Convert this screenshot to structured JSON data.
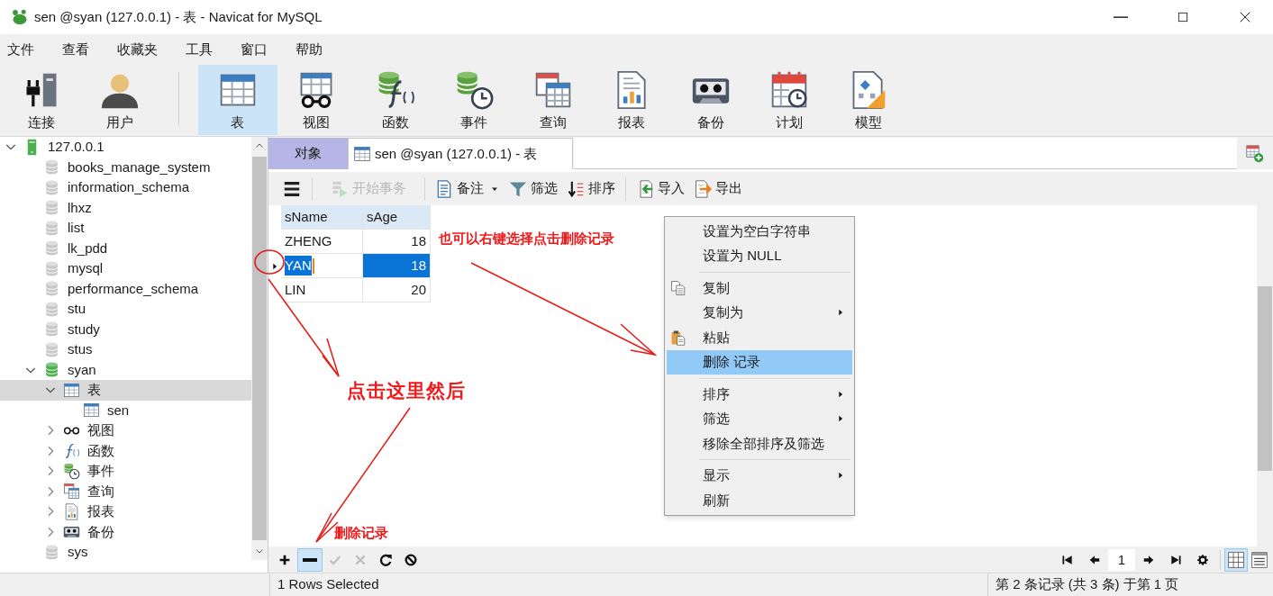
{
  "window": {
    "title": "sen @syan (127.0.0.1) - 表 - Navicat for MySQL"
  },
  "menu": [
    "文件",
    "查看",
    "收藏夹",
    "工具",
    "窗口",
    "帮助"
  ],
  "toolbar": {
    "connection": [
      {
        "kind": "connect",
        "label": "连接",
        "selected": false
      },
      {
        "kind": "user",
        "label": "用户",
        "selected": false
      }
    ],
    "objects": [
      {
        "kind": "table",
        "label": "表",
        "selected": true
      },
      {
        "kind": "view",
        "label": "视图",
        "selected": false
      },
      {
        "kind": "function",
        "label": "函数",
        "selected": false
      },
      {
        "kind": "event",
        "label": "事件",
        "selected": false
      },
      {
        "kind": "query",
        "label": "查询",
        "selected": false
      },
      {
        "kind": "report",
        "label": "报表",
        "selected": false
      },
      {
        "kind": "backup",
        "label": "备份",
        "selected": false
      },
      {
        "kind": "schedule",
        "label": "计划",
        "selected": false
      },
      {
        "kind": "model",
        "label": "模型",
        "selected": false
      }
    ]
  },
  "tree": [
    {
      "label": "127.0.0.1",
      "kind": "server",
      "expanded": true,
      "selected": false,
      "children": [
        {
          "label": "books_manage_system",
          "kind": "database",
          "open": false,
          "selected": false
        },
        {
          "label": "information_schema",
          "kind": "database",
          "open": false,
          "selected": false
        },
        {
          "label": "lhxz",
          "kind": "database",
          "open": false,
          "selected": false
        },
        {
          "label": "list",
          "kind": "database",
          "open": false,
          "selected": false
        },
        {
          "label": "lk_pdd",
          "kind": "database",
          "open": false,
          "selected": false
        },
        {
          "label": "mysql",
          "kind": "database",
          "open": false,
          "selected": false
        },
        {
          "label": "performance_schema",
          "kind": "database",
          "open": false,
          "selected": false
        },
        {
          "label": "stu",
          "kind": "database",
          "open": false,
          "selected": false
        },
        {
          "label": "study",
          "kind": "database",
          "open": false,
          "selected": false
        },
        {
          "label": "stus",
          "kind": "database",
          "open": false,
          "selected": false
        },
        {
          "label": "syan",
          "kind": "database",
          "open": true,
          "expanded": true,
          "selected": false,
          "children": [
            {
              "label": "表",
              "kind": "tables",
              "expanded": true,
              "selected": true,
              "children": [
                {
                  "label": "sen",
                  "kind": "table",
                  "selected": false
                }
              ]
            },
            {
              "label": "视图",
              "kind": "views",
              "expanded": false,
              "selected": false
            },
            {
              "label": "函数",
              "kind": "functions",
              "expanded": false,
              "selected": false
            },
            {
              "label": "事件",
              "kind": "events",
              "expanded": false,
              "selected": false
            },
            {
              "label": "查询",
              "kind": "queries",
              "expanded": false,
              "selected": false
            },
            {
              "label": "报表",
              "kind": "reports",
              "expanded": false,
              "selected": false
            },
            {
              "label": "备份",
              "kind": "backups",
              "expanded": false,
              "selected": false
            }
          ]
        },
        {
          "label": "sys",
          "kind": "database",
          "open": false,
          "selected": false
        }
      ]
    }
  ],
  "tabs": [
    {
      "label": "对象",
      "kind": "objects",
      "selected": false
    },
    {
      "label": "sen @syan (127.0.0.1) - 表",
      "kind": "table",
      "selected": true
    }
  ],
  "grid_toolbar": [
    [
      {
        "kind": "menu",
        "disabled": false,
        "dropdown": false
      }
    ],
    [
      {
        "kind": "begin-transaction",
        "label": "开始事务",
        "disabled": true,
        "dropdown": false
      }
    ],
    [
      {
        "kind": "note",
        "label": "备注",
        "disabled": false,
        "dropdown": true
      },
      {
        "kind": "filter",
        "label": "筛选",
        "disabled": false,
        "dropdown": false
      },
      {
        "kind": "sort",
        "label": "排序",
        "disabled": false,
        "dropdown": false
      }
    ],
    [
      {
        "kind": "import",
        "label": "导入",
        "disabled": false,
        "dropdown": false
      },
      {
        "kind": "export",
        "label": "导出",
        "disabled": false,
        "dropdown": false
      }
    ]
  ],
  "table": {
    "columns": [
      {
        "label": "sName",
        "kind": "text"
      },
      {
        "label": "sAge",
        "kind": "number"
      }
    ],
    "rows": [
      {
        "cells": [
          "ZHENG",
          "18"
        ],
        "selected": false
      },
      {
        "cells": [
          "YAN",
          "18"
        ],
        "selected": true
      },
      {
        "cells": [
          "LIN",
          "20"
        ],
        "selected": false
      }
    ]
  },
  "context_menu": [
    [
      {
        "label": "设置为空白字符串",
        "kind": "plain",
        "submenu": false,
        "selected": false
      },
      {
        "label": "设置为 NULL",
        "kind": "plain",
        "submenu": false,
        "selected": false
      }
    ],
    [
      {
        "label": "复制",
        "kind": "copy",
        "submenu": false,
        "selected": false
      },
      {
        "label": "复制为",
        "kind": "plain",
        "submenu": true,
        "selected": false
      },
      {
        "label": "粘贴",
        "kind": "paste",
        "submenu": false,
        "selected": false
      },
      {
        "label": "删除 记录",
        "kind": "plain",
        "submenu": false,
        "selected": true
      }
    ],
    [
      {
        "label": "排序",
        "kind": "plain",
        "submenu": true,
        "selected": false
      },
      {
        "label": "筛选",
        "kind": "plain",
        "submenu": true,
        "selected": false
      },
      {
        "label": "移除全部排序及筛选",
        "kind": "plain",
        "submenu": false,
        "selected": false
      }
    ],
    [
      {
        "label": "显示",
        "kind": "plain",
        "submenu": true,
        "selected": false
      },
      {
        "label": "刷新",
        "kind": "plain",
        "submenu": false,
        "selected": false
      }
    ]
  ],
  "record_toolbar": [
    {
      "kind": "add",
      "disabled": false,
      "selected": false
    },
    {
      "kind": "delete",
      "disabled": false,
      "selected": true
    },
    {
      "kind": "apply",
      "disabled": true,
      "selected": false
    },
    {
      "kind": "discard",
      "disabled": true,
      "selected": false
    },
    {
      "kind": "refresh",
      "disabled": false,
      "selected": false
    },
    {
      "kind": "stop",
      "disabled": false,
      "selected": false
    }
  ],
  "pager": {
    "page": "1"
  },
  "view_modes": [
    {
      "kind": "grid",
      "selected": true
    },
    {
      "kind": "form",
      "selected": false
    }
  ],
  "status_bar": {
    "selection": "1 Rows Selected",
    "position": "第 2 条记录 (共 3 条) 于第 1 页"
  },
  "annotations": [
    {
      "kind": "note",
      "text": "也可以右键选择点击删除记录"
    },
    {
      "kind": "callout",
      "text": "点击这里然后"
    },
    {
      "kind": "note",
      "text": "删除记录"
    }
  ]
}
